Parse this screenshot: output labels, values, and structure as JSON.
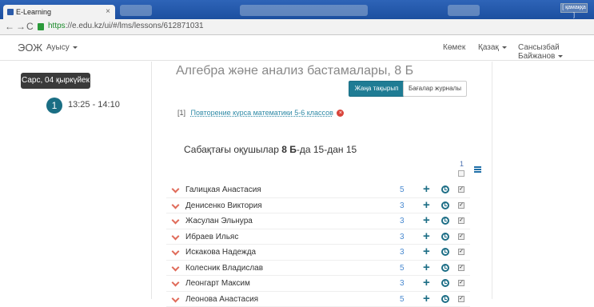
{
  "browser": {
    "tab_title": "E-Learning",
    "tab_close": "×",
    "url_https": "https",
    "url_rest": "://e.edu.kz/ui/#/lms/lessons/612871031",
    "user_badge": "[ қамаққа ]"
  },
  "appnav": {
    "brand": "ЭОЖ",
    "menu": "Ауысу",
    "help": "Көмек",
    "lang": "Қазақ",
    "user": "Сансызбай Байжанов"
  },
  "left": {
    "date": "Сарс, 04 қыркүйек",
    "lesson_number": "1",
    "lesson_time": "13:25 - 14:10"
  },
  "main": {
    "title": "Алгебра және анализ бастамалары, 8 Б",
    "btn_new_topic": "Жаңа тақырып",
    "btn_journal": "Бағалар журналы",
    "topic_index": "[1]",
    "topic_link": "Повторение курса математики 5-6  классов",
    "students_prefix": "Сабақтағы оқушылар ",
    "students_class": "8 Б",
    "students_suffix": "-да 15-дан 15",
    "column_count": "1"
  },
  "students": [
    {
      "name": "Галицкая Анастасия",
      "grade": "5"
    },
    {
      "name": "Денисенко Виктория",
      "grade": "3"
    },
    {
      "name": "Жасулан Эльнура",
      "grade": "3"
    },
    {
      "name": "Ибраев Ильяс",
      "grade": "3"
    },
    {
      "name": "Искакова Надежда",
      "grade": "3"
    },
    {
      "name": "Колесник Владислав",
      "grade": "5"
    },
    {
      "name": "Леонгарт Максим",
      "grade": "3"
    },
    {
      "name": "Леонова Анастасия",
      "grade": "5"
    }
  ],
  "colors": {
    "accent": "#1f7c94",
    "chevron": "#e06b5a",
    "grade": "#4a8ad0"
  }
}
